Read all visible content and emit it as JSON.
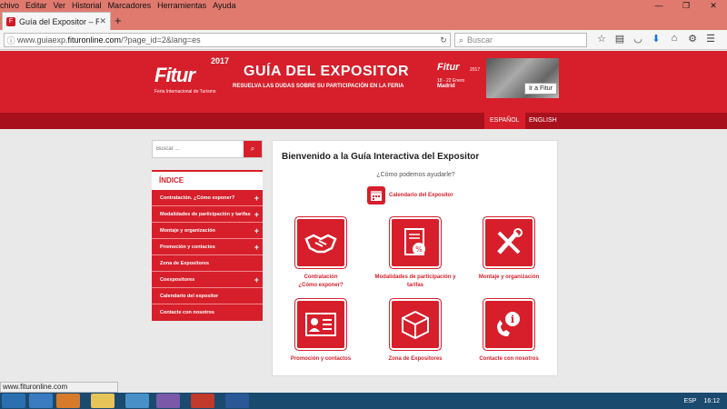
{
  "browser": {
    "menu": [
      "chivo",
      "Editar",
      "Ver",
      "Historial",
      "Marcadores",
      "Herramientas",
      "Ayuda"
    ],
    "tab_title": "Guía del Expositor – Resue...",
    "url_prefix": "www.guiaexp.",
    "url_domain": "fituronline.com",
    "url_suffix": "/?page_id=2&lang=es",
    "search_placeholder": "Buscar",
    "status_url": "www.fituronline.com"
  },
  "header": {
    "logo": "Fitur",
    "logo_year": "2017",
    "logo_sub": "Feria Internacional de Turismo",
    "title": "GUÍA DEL EXPOSITOR",
    "subtitle": "RESUELVA LAS DUDAS SOBRE SU PARTICIPACIÓN EN LA FERIA",
    "banner": {
      "logo": "Fitur",
      "year": "2017",
      "dates": "18 - 22 Enero",
      "city": "Madrid",
      "button": "Ir a Fitur"
    }
  },
  "lang": {
    "es": "ESPAÑOL",
    "en": "ENGLISH"
  },
  "sidebar": {
    "search_placeholder": "Buscar ...",
    "index_title": "ÍNDICE",
    "items": [
      {
        "label": "Contratación. ¿Cómo exponer?",
        "expandable": true
      },
      {
        "label": "Modalidades de participación y tarifas",
        "expandable": true
      },
      {
        "label": "Montaje y organización",
        "expandable": true
      },
      {
        "label": "Promoción y contactos",
        "expandable": true
      },
      {
        "label": "Zona de Expositores",
        "expandable": false
      },
      {
        "label": "Coexpositores",
        "expandable": true
      },
      {
        "label": "Calendario del expositor",
        "expandable": false
      },
      {
        "label": "Contacte con nosotros",
        "expandable": false
      }
    ]
  },
  "main": {
    "title": "Bienvenido a la Guía Interactiva del Expositor",
    "question": "¿Cómo podemos ayudarle?",
    "calendar_label": "Calendario del Expositor",
    "tiles": [
      {
        "line1": "Contratación",
        "line2": "¿Cómo exponer?",
        "icon": "handshake-icon"
      },
      {
        "line1": "Modalidades de participación y",
        "line2": "tarifas",
        "icon": "document-percent-icon"
      },
      {
        "line1": "Montaje y organización",
        "line2": "",
        "icon": "tools-icon"
      },
      {
        "line1": "Promoción y contactos",
        "line2": "",
        "icon": "id-card-icon"
      },
      {
        "line1": "Zona de Expositores",
        "line2": "",
        "icon": "cube-icon"
      },
      {
        "line1": "Contacte con nosotros",
        "line2": "",
        "icon": "phone-info-icon"
      }
    ]
  },
  "taskbar": {
    "lang": "ESP",
    "time": "16:12"
  },
  "colors": {
    "brand_red": "#d61f2b",
    "dark_red": "#a8101c",
    "chrome_red": "#e07a6f",
    "taskbar": "#1a4a6e"
  }
}
